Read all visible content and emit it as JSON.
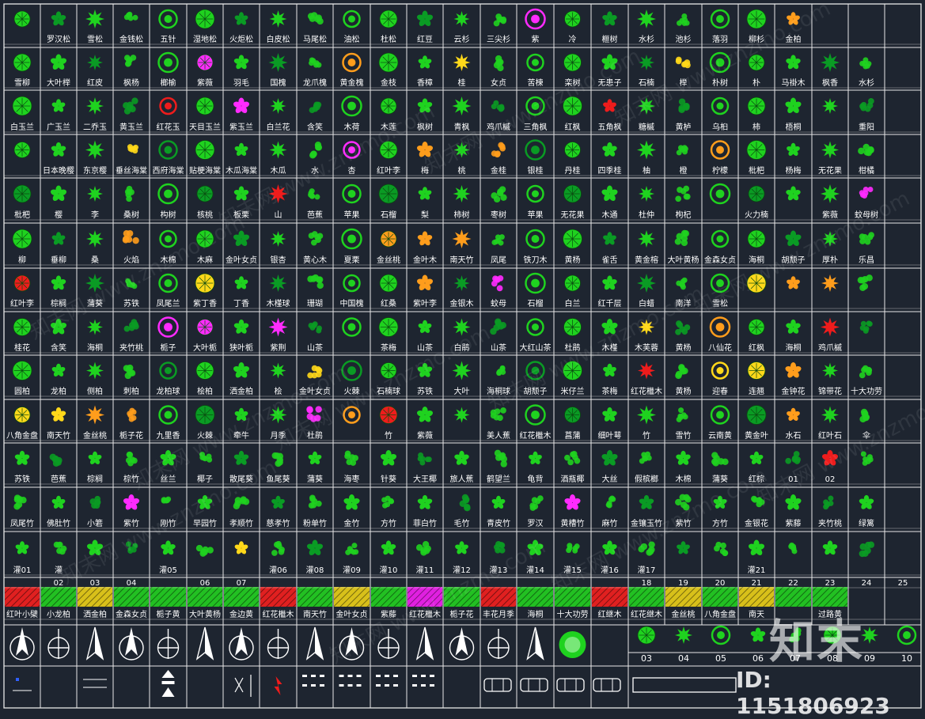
{
  "colors": {
    "background": "#1e2530",
    "grid_line": "#e8e8e8",
    "label": "#ffffff",
    "plant_green": "#1fd21f",
    "dark_green": "#0a9b24",
    "magenta": "#ff2bff",
    "orange": "#ff9d1c",
    "red": "#ee1c1c",
    "yellow": "#ffd81a",
    "hatch_red": "#e02020",
    "hatch_yellow": "#d8c01a",
    "hatch_green": "#22c022",
    "hatch_magenta": "#e020e0"
  },
  "rows": [
    {
      "labels": [
        "",
        "罗汉松",
        "雪松",
        "金钱松",
        "五针",
        "湿地松",
        "火炬松",
        "白皮松",
        "马尾松",
        "油松",
        "杜松",
        "红豆",
        "云杉",
        "三尖杉",
        "紫",
        "冷",
        "榧树",
        "水杉",
        "池杉",
        "落羽",
        "柳杉",
        "金柏",
        "",
        ""
      ]
    },
    {
      "labels": [
        "雪柳",
        "大叶榉",
        "红皮",
        "枫杨",
        "榔榆",
        "紫薇",
        "羽毛",
        "国槐",
        "龙爪槐",
        "黄金槐",
        "金枝",
        "香樟",
        "桂",
        "女贞",
        "苦楝",
        "栾树",
        "无患子",
        "石楠",
        "榉",
        "朴树",
        "朴",
        "马褂木",
        "枫香",
        "水杉"
      ]
    },
    {
      "labels": [
        "白玉兰",
        "广玉兰",
        "二乔玉",
        "黄玉兰",
        "红花玉",
        "天目玉兰",
        "紫玉兰",
        "白兰花",
        "含笑",
        "木荷",
        "木莲",
        "枫树",
        "青枫",
        "鸡爪槭",
        "三角枫",
        "红枫",
        "五角枫",
        "糖槭",
        "黄栌",
        "乌桕",
        "柿",
        "梧桐",
        "",
        "重阳"
      ]
    },
    {
      "labels": [
        "",
        "日本晚樱",
        "东京樱",
        "垂丝海棠",
        "西府海棠",
        "贴梗海棠",
        "木瓜海棠",
        "木瓜",
        "水",
        "杏",
        "红叶李",
        "梅",
        "桃",
        "金桂",
        "银桂",
        "丹桂",
        "四季桂",
        "柚",
        "橙",
        "柠檬",
        "枇杷",
        "杨梅",
        "无花果",
        "柑橘"
      ]
    },
    {
      "labels": [
        "枇杷",
        "樱",
        "李",
        "桑树",
        "构树",
        "核桃",
        "板栗",
        "山",
        "芭蕉",
        "苹果",
        "石榴",
        "梨",
        "柿树",
        "枣树",
        "苹果",
        "无花果",
        "木通",
        "杜仲",
        "枸杞",
        "",
        "火力楠",
        "",
        "紫薇",
        "蚊母树"
      ]
    },
    {
      "labels": [
        "柳",
        "垂柳",
        "桑",
        "火焰",
        "木棉",
        "木麻",
        "金叶女贞",
        "银杏",
        "黄心木",
        "夏栗",
        "金丝桃",
        "金叶木",
        "南天竹",
        "凤尾",
        "铁刀木",
        "黄杨",
        "雀舌",
        "黄金榕",
        "大叶黄杨",
        "金森女贞",
        "海桐",
        "胡颓子",
        "厚朴",
        "乐昌"
      ]
    },
    {
      "labels": [
        "红叶李",
        "棕榈",
        "蒲葵",
        "苏铁",
        "凤尾兰",
        "紫丁香",
        "丁香",
        "木槿球",
        "珊瑚",
        "中国槐",
        "红桑",
        "紫叶李",
        "金银木",
        "蚊母",
        "石榴",
        "白兰",
        "红千层",
        "白蜡",
        "南洋",
        "雪松",
        "",
        "",
        "",
        ""
      ]
    },
    {
      "labels": [
        "桂花",
        "含笑",
        "海桐",
        "夹竹桃",
        "栀子",
        "大叶栀",
        "狭叶栀",
        "紫荆",
        "山茶",
        "",
        "茶梅",
        "山茶",
        "白鹃",
        "山茶",
        "大红山茶",
        "杜鹃",
        "木槿",
        "木芙蓉",
        "黄杨",
        "八仙花",
        "红枫",
        "海桐",
        "鸡爪槭",
        ""
      ]
    },
    {
      "labels": [
        "圆柏",
        "龙柏",
        "侧柏",
        "刺柏",
        "龙柏球",
        "桧柏",
        "洒金柏",
        "桧",
        "金叶女贞",
        "火棘",
        "石楠球",
        "苏铁",
        "大叶",
        "海桐球",
        "胡颓子",
        "米仔兰",
        "茶梅",
        "红花檵木",
        "黄杨",
        "迎春",
        "连翘",
        "金钟花",
        "锦带花",
        "十大功劳"
      ]
    },
    {
      "labels": [
        "八角金盘",
        "南天竹",
        "金丝桃",
        "栀子花",
        "九里香",
        "火棘",
        "牵牛",
        "月季",
        "杜鹃",
        "",
        "竹",
        "紫薇",
        "",
        "美人蕉",
        "红花檵木",
        "菖蒲",
        "细叶萼",
        "竹",
        "雪竹",
        "云南黄",
        "黄金叶",
        "水石",
        "红叶石",
        "伞"
      ]
    },
    {
      "labels": [
        "苏铁",
        "芭蕉",
        "棕榈",
        "棕竹",
        "丝兰",
        "椰子",
        "散尾葵",
        "鱼尾葵",
        "蒲葵",
        "海枣",
        "针葵",
        "大王椰",
        "旅人蕉",
        "鹤望兰",
        "龟背",
        "酒瓶椰",
        "大丝",
        "假槟榔",
        "木棉",
        "蒲葵",
        "红棕",
        "01",
        "02",
        ""
      ]
    },
    {
      "labels": [
        "凤尾竹",
        "佛肚竹",
        "小箬",
        "紫竹",
        "刚竹",
        "早园竹",
        "孝顺竹",
        "慈孝竹",
        "粉单竹",
        "金竹",
        "方竹",
        "菲白竹",
        "毛竹",
        "青皮竹",
        "罗汉",
        "黄槽竹",
        "麻竹",
        "金镶玉竹",
        "紫竹",
        "方竹",
        "金银花",
        "紫藤",
        "夹竹桃",
        "绿篱"
      ]
    },
    {
      "labels": [
        "灌01",
        "灌",
        "",
        "",
        "灌05",
        "",
        "",
        "灌06",
        "灌08",
        "灌09",
        "灌10",
        "灌11",
        "灌12",
        "灌13",
        "灌14",
        "灌15",
        "灌16",
        "灌17",
        "",
        "",
        "灌21",
        "",
        "",
        ""
      ]
    },
    {
      "labels": [
        "",
        "02",
        "03",
        "04",
        "",
        "06",
        "07",
        "",
        "",
        "",
        "",
        "",
        "",
        "",
        "",
        "",
        "",
        "18",
        "19",
        "20",
        "21",
        "22",
        "23",
        "24",
        "25"
      ]
    },
    {
      "labels": [
        "红叶小檗",
        "小龙柏",
        "洒金柏",
        "金森女贞",
        "栀子黄",
        "大叶黄杨",
        "金边黄",
        "红花檵木",
        "南天竹",
        "金叶女贞",
        "紫藤",
        "红花檵木",
        "栀子花",
        "丰花月季",
        "海桐",
        "十大功劳",
        "红继木",
        "红花继木",
        "金丝桃",
        "八角金盘",
        "南天",
        "",
        "过路黄",
        ""
      ]
    }
  ],
  "bottom_row_numbers": [
    "03",
    "04",
    "05",
    "06",
    "07",
    "08",
    "09",
    "10"
  ],
  "brand": {
    "logo": "知末",
    "id": "ID: 1151806923"
  },
  "watermark": "知末网 www.znzmo.com"
}
